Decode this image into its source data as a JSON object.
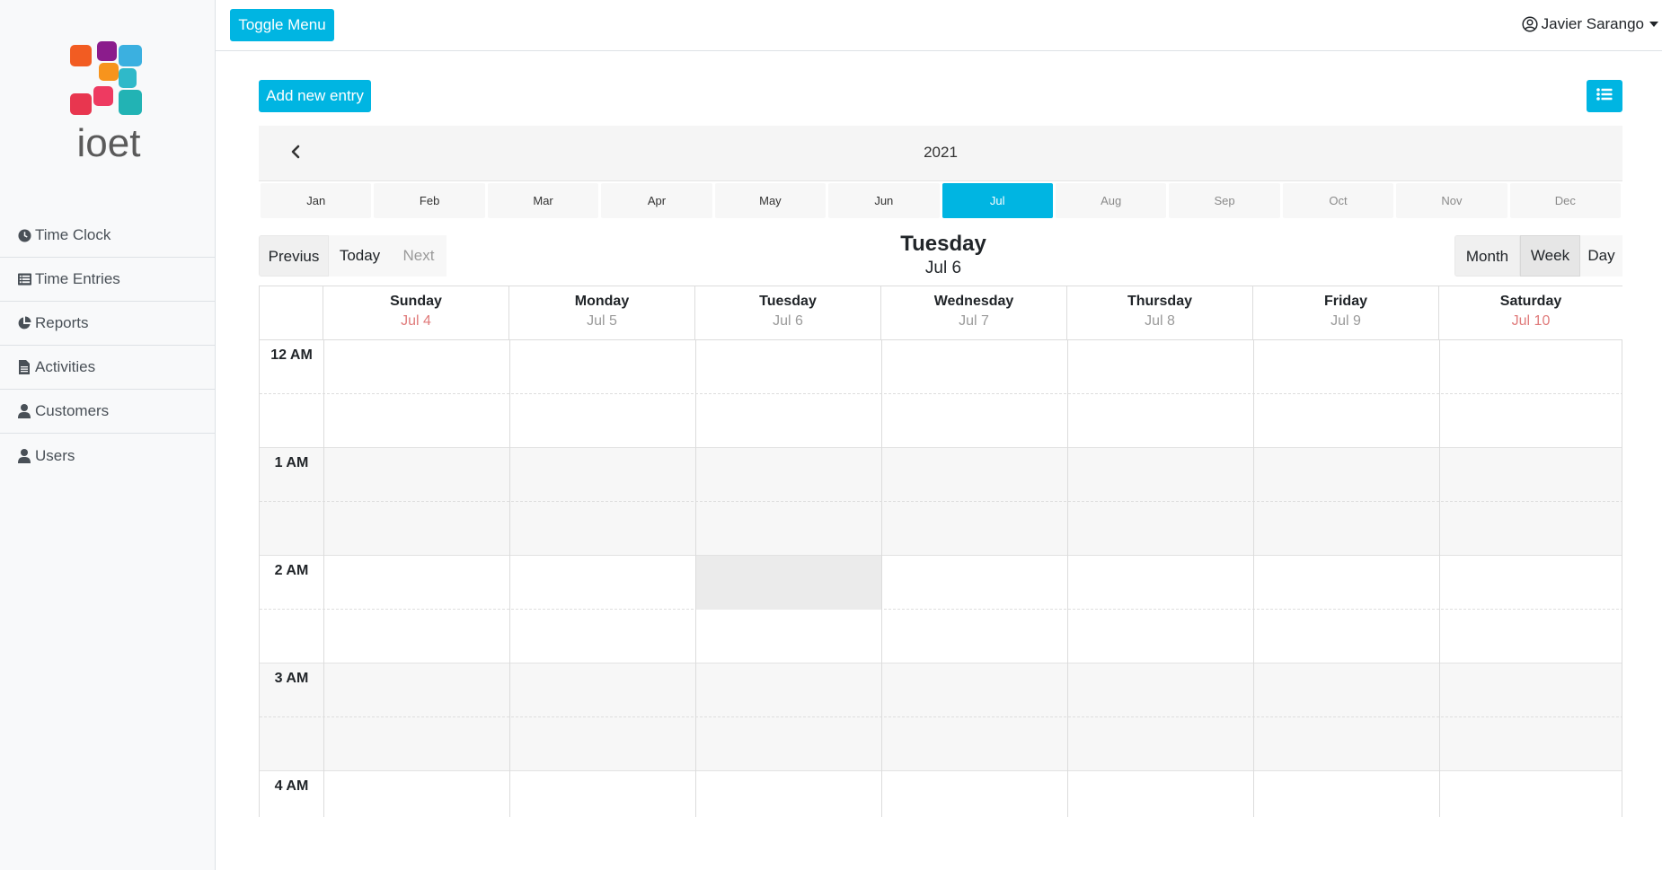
{
  "sidebar": {
    "brand": "ioet",
    "items": [
      {
        "label": "Time Clock",
        "icon": "clock-icon"
      },
      {
        "label": "Time Entries",
        "icon": "list-icon"
      },
      {
        "label": "Reports",
        "icon": "pie-chart-icon"
      },
      {
        "label": "Activities",
        "icon": "file-icon"
      },
      {
        "label": "Customers",
        "icon": "user-icon"
      },
      {
        "label": "Users",
        "icon": "user-icon"
      }
    ]
  },
  "topbar": {
    "toggle_label": "Toggle Menu",
    "user_name": "Javier Sarango"
  },
  "main": {
    "add_entry_label": "Add new entry",
    "year": "2021",
    "months": [
      "Jan",
      "Feb",
      "Mar",
      "Apr",
      "May",
      "Jun",
      "Jul",
      "Aug",
      "Sep",
      "Oct",
      "Nov",
      "Dec"
    ],
    "selected_month": "Jul",
    "nav": {
      "previous": "Previus",
      "today": "Today",
      "next": "Next"
    },
    "title_day": "Tuesday",
    "title_date": "Jul 6",
    "views": {
      "month": "Month",
      "week": "Week",
      "day": "Day"
    },
    "selected_view": "Week"
  },
  "calendar": {
    "days": [
      {
        "name": "Sunday",
        "date": "Jul 4",
        "weekend": true
      },
      {
        "name": "Monday",
        "date": "Jul 5",
        "weekend": false
      },
      {
        "name": "Tuesday",
        "date": "Jul 6",
        "weekend": false
      },
      {
        "name": "Wednesday",
        "date": "Jul 7",
        "weekend": false
      },
      {
        "name": "Thursday",
        "date": "Jul 8",
        "weekend": false
      },
      {
        "name": "Friday",
        "date": "Jul 9",
        "weekend": false
      },
      {
        "name": "Saturday",
        "date": "Jul 10",
        "weekend": true
      }
    ],
    "hours": [
      "12 AM",
      "1 AM",
      "2 AM",
      "3 AM",
      "4 AM"
    ]
  },
  "colors": {
    "accent": "#00b5e2",
    "weekend_date": "#e07b7b",
    "muted_date": "#9a9a9a"
  }
}
